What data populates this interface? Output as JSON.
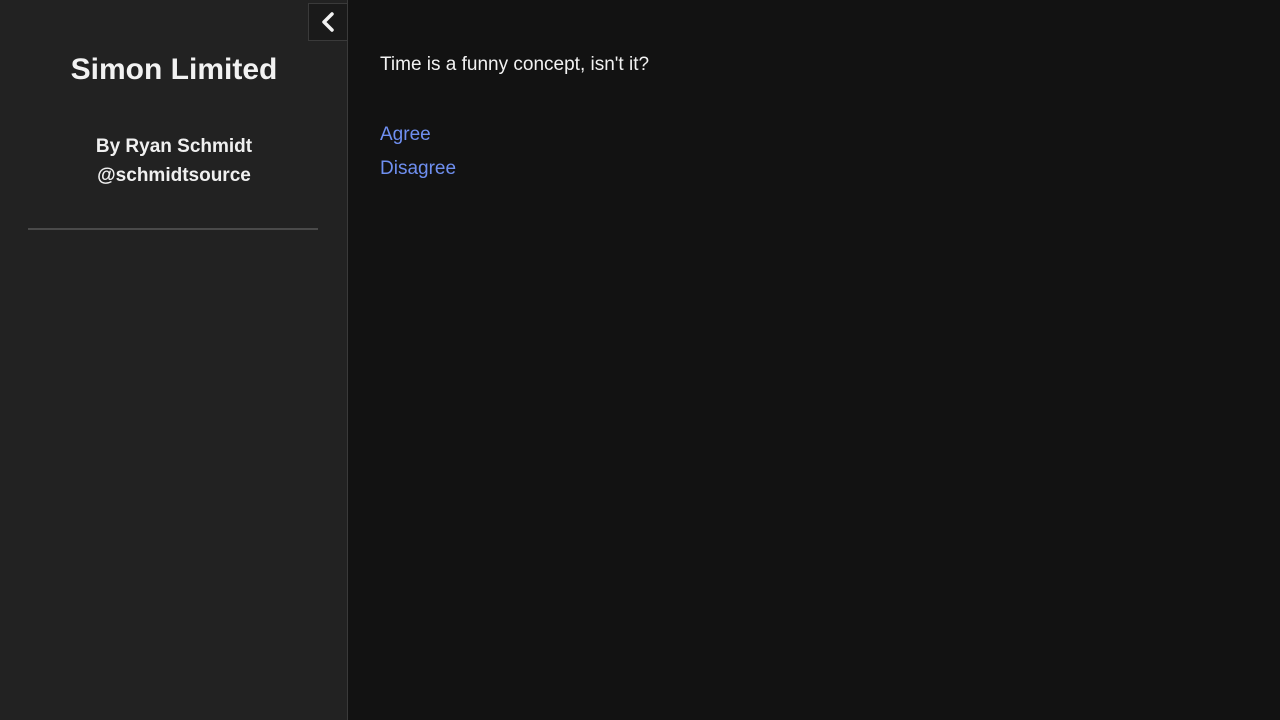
{
  "sidebar": {
    "title": "Simon Limited",
    "byline_author": "By Ryan Schmidt",
    "byline_handle": "@schmidtsource",
    "collapse_icon": "chevron-left-icon"
  },
  "passage": {
    "text": "Time is a funny concept, isn't it?",
    "choices": [
      {
        "label": "Agree"
      },
      {
        "label": "Disagree"
      }
    ]
  },
  "colors": {
    "sidebar_bg": "#222222",
    "main_bg": "#121212",
    "link": "#6f8ff0",
    "text": "#f2f2f2"
  }
}
